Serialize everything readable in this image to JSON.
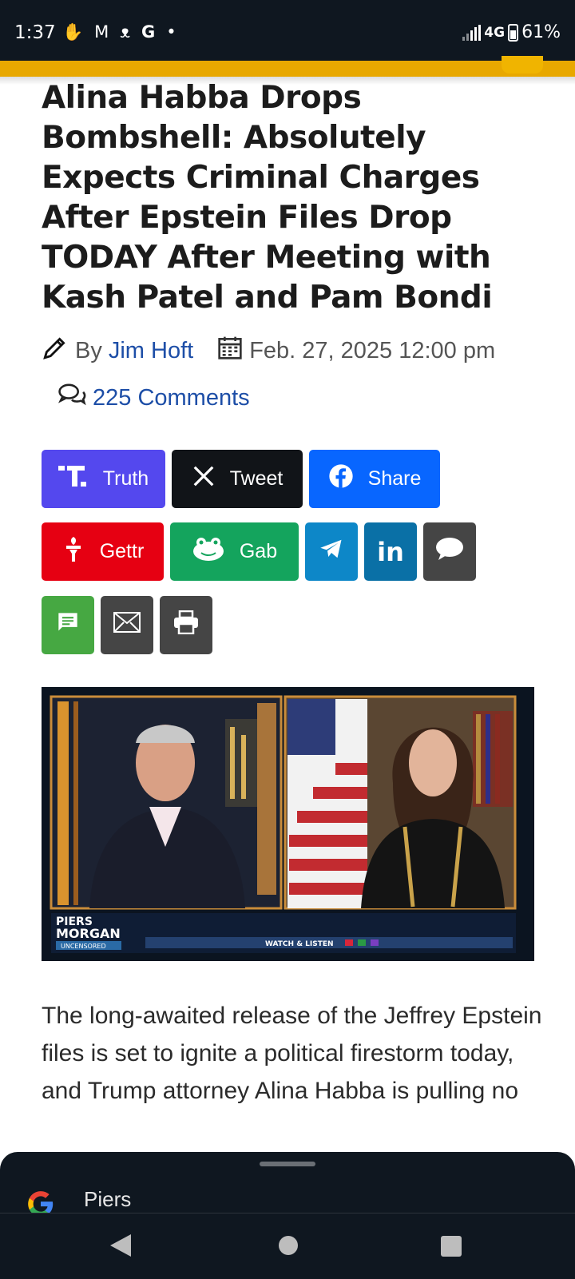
{
  "status_bar": {
    "time": "1:37",
    "network": "4G",
    "battery": "61%"
  },
  "article": {
    "headline": "Alina Habba Drops Bombshell: Absolutely Expects Criminal Charges After Epstein Files Drop TODAY After Meeting with Kash Patel and Pam Bondi",
    "by_label": "By",
    "author": "Jim Hoft",
    "date": "Feb. 27, 2025 12:00 pm",
    "comments": "225 Comments",
    "body_text": "The long-awaited release of the Jeffrey Epstein files is set to ignite a political firestorm today, and Trump attorney Alina Habba is pulling no"
  },
  "share_buttons": {
    "truth": "Truth",
    "tweet": "Tweet",
    "share": "Share",
    "gettr": "Gettr",
    "gab": "Gab",
    "telegram_icon": "telegram-icon",
    "linkedin_icon": "linkedin-icon",
    "message_icon": "chat-bubble-icon",
    "sms_icon": "sms-icon",
    "email_icon": "email-icon",
    "print_icon": "print-icon"
  },
  "photo": {
    "show_name_line1": "PIERS",
    "show_name_line2": "MORGAN",
    "show_tag": "UNCENSORED",
    "ticker": "WATCH & LISTEN"
  },
  "bottom_sheet": {
    "label": "Piers"
  },
  "colors": {
    "accent_yellow": "#e8a800",
    "link_blue": "#1d4ea7",
    "truth": "#5448ee",
    "facebook": "#0866ff",
    "gettr": "#e60012",
    "gab": "#14a45d"
  }
}
